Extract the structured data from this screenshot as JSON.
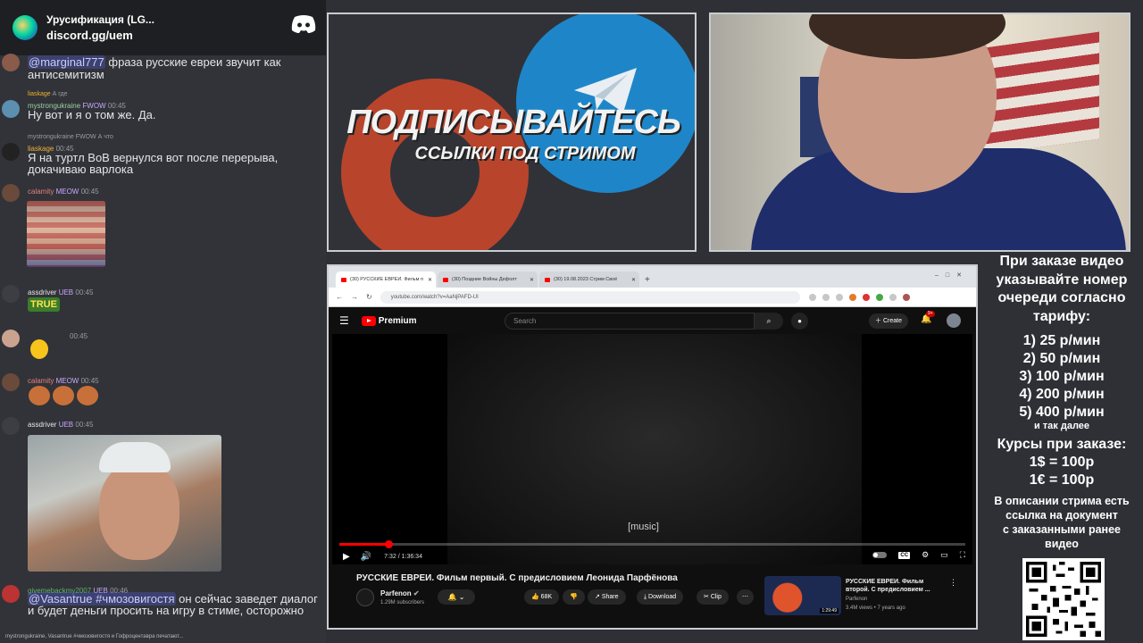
{
  "discord": {
    "server_title": "Урусификация (LG...",
    "server_invite": "discord.gg/uem",
    "messages": [
      {
        "mention": "@marginal777",
        "text": "фраза русские евреи звучит как антисемитизм"
      },
      {
        "reply_name": "liaskage",
        "reply_text": "А где",
        "author": "mystrongukraine",
        "badge": "FWOW",
        "time": "00:45",
        "text": "Ну вот и я о том же. Да."
      },
      {
        "reply_name": "mystrongukraine",
        "reply_badge": "FWOW",
        "reply_text": "А что",
        "author": "liaskage",
        "time": "00:45",
        "text": "Я на туртл BoB вернулся вот после перерыва, докачиваю варлока"
      },
      {
        "author": "calamity",
        "badge": "MEOW",
        "time": "00:45"
      },
      {
        "author": "assdriver",
        "badge": "UEB",
        "time": "00:45",
        "sticker": "TRUE"
      },
      {
        "time": "00:45"
      },
      {
        "author": "calamity",
        "badge": "MEOW",
        "time": "00:45"
      },
      {
        "author": "assdriver",
        "badge": "UEB",
        "time": "00:45"
      },
      {
        "author": "givemebackmy2007",
        "badge": "UEB",
        "time": "00:46",
        "mention": "@Vasantrue #чмозовигостя",
        "text": "он сейчас заведет диалог и будет деньги просить на игру в стиме, осторожно"
      }
    ],
    "typing": "mystrongukraine, Vasantrue #чмозовигостя и Гофроцентавра печатают..."
  },
  "promo": {
    "headline": "ПОДПИСЫВАЙТЕСЬ",
    "subline": "ССЫЛКИ ПОД СТРИМОМ"
  },
  "browser": {
    "tabs": [
      {
        "label": "(30) РУССКИЕ ЕВРЕИ. Фильм п",
        "active": true
      },
      {
        "label": "(30) Поздние Войны Дефолт",
        "active": false
      },
      {
        "label": "(30) 19.08.2023 Стрим Своё",
        "active": false
      }
    ],
    "url": "youtube.com/watch?v=AaNjPAFD-UI"
  },
  "youtube": {
    "logo_label": "Premium",
    "search_placeholder": "Search",
    "create_label": "Create",
    "notif_count": "9+",
    "subtitle": "[music]",
    "time": "7:32 / 1:36:34",
    "progress_fraction": 0.078,
    "video_title": "РУССКИЕ ЕВРЕИ. Фильм первый. С предисловием Леонида Парфёнова",
    "channel_name": "Parfenon",
    "channel_subs": "1.29M subscribers",
    "likes": "68K",
    "share_label": "Share",
    "download_label": "Download",
    "clip_label": "Clip",
    "rec_title": "РУССКИЕ ЕВРЕИ. Фильм второй. С предисловием ...",
    "rec_channel": "Parfenon",
    "rec_views": "3.4M views • 7 years ago",
    "rec_duration": "1:29:49"
  },
  "info": {
    "intro": [
      "При заказе видео",
      "указывайте номер",
      "очереди согласно",
      "тарифу:"
    ],
    "tariffs": [
      "1) 25 р/мин",
      "2) 50 р/мин",
      "3) 100 р/мин",
      "4) 200 р/мин",
      "5) 400 р/мин"
    ],
    "and_so_on": "и так далее",
    "rates_title": "Курсы при заказе:",
    "rates": [
      "1$ = 100р",
      "1€ = 100р"
    ],
    "desc": [
      "В описании стрима есть",
      "ссылка на документ",
      "с заказанными ранее",
      "видео"
    ]
  },
  "colors": {
    "accent_red": "#ff0000",
    "discord_bg": "#313338",
    "telegram_blue": "#1e86c8"
  }
}
